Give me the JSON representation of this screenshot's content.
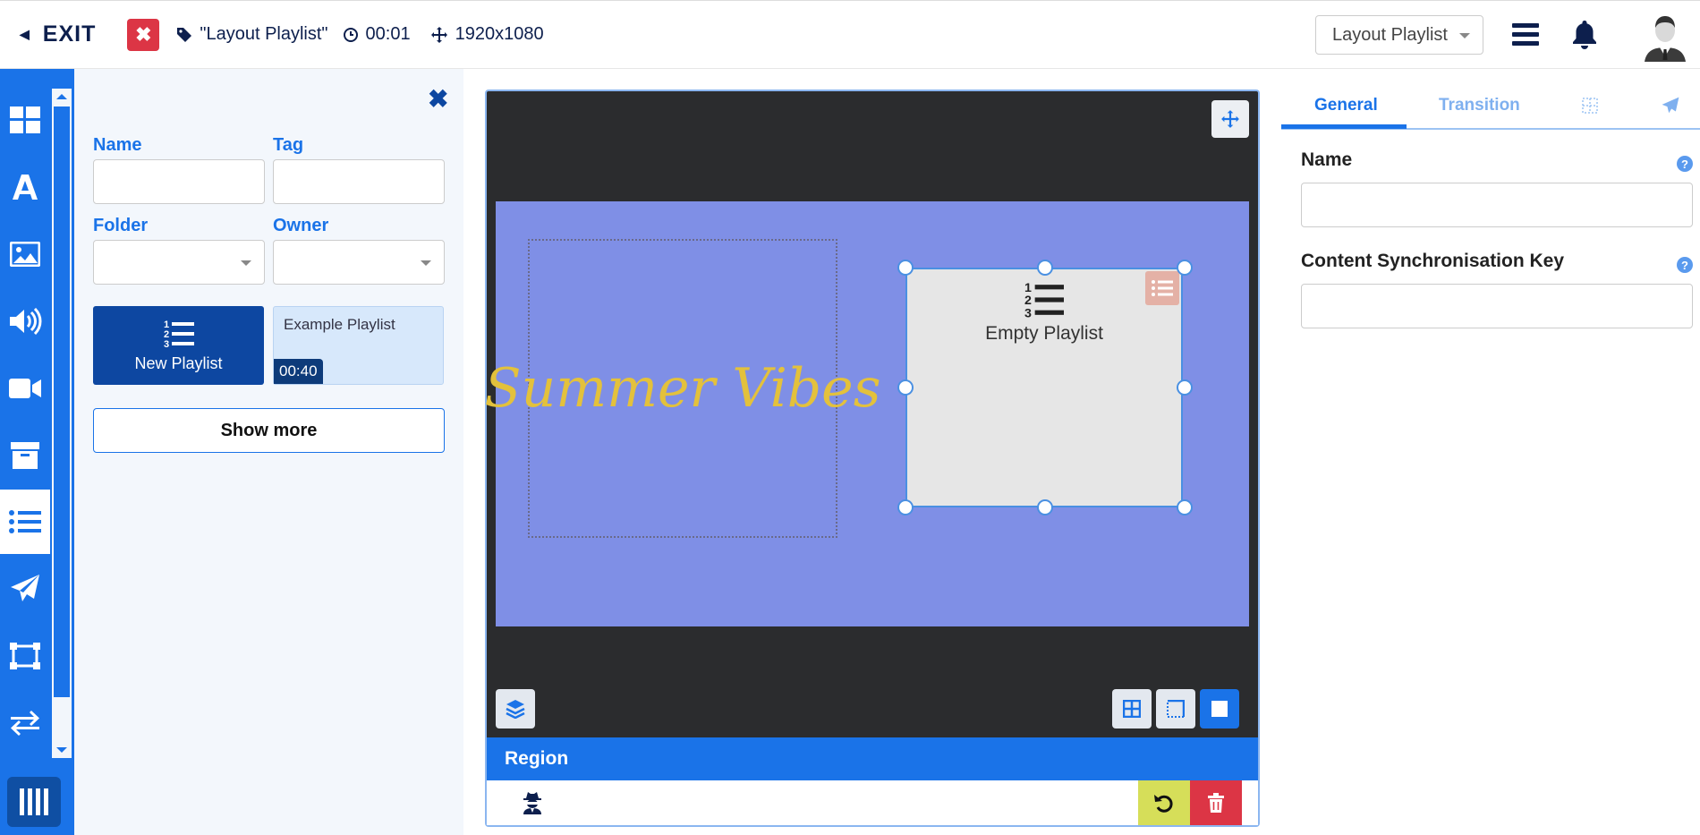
{
  "topbar": {
    "exit_label": "EXIT",
    "layout_name": "\"Layout Playlist\"",
    "duration": "00:01",
    "resolution": "1920x1080",
    "layout_select": "Layout Playlist"
  },
  "toolbar": {
    "items": [
      "layouts-icon",
      "text-icon",
      "image-icon",
      "audio-icon",
      "video-icon",
      "library-icon",
      "playlist-icon",
      "send-icon",
      "region-icon",
      "transition-icon"
    ],
    "active_index": 6
  },
  "library": {
    "name_label": "Name",
    "tag_label": "Tag",
    "folder_label": "Folder",
    "owner_label": "Owner",
    "name_value": "",
    "tag_value": "",
    "new_card_label": "New Playlist",
    "example_card_label": "Example Playlist",
    "example_card_duration": "00:40",
    "show_more_label": "Show more"
  },
  "stage": {
    "text_widget": "Summer Vibes",
    "playlist_widget_label": "Empty Playlist",
    "region_bar_label": "Region"
  },
  "properties": {
    "tabs": [
      "General",
      "Transition"
    ],
    "active_tab": "General",
    "name_label": "Name",
    "name_value": "",
    "sync_key_label": "Content Synchronisation Key",
    "sync_key_value": ""
  },
  "colors": {
    "primary": "#1a73e8",
    "dark_navy": "#0d1f4d",
    "canvas_bg": "#7f8fe6",
    "stage_bg": "#2b2c2e",
    "danger": "#dc3545",
    "undo": "#d6de59",
    "text_widget_color": "#e3c13c"
  }
}
